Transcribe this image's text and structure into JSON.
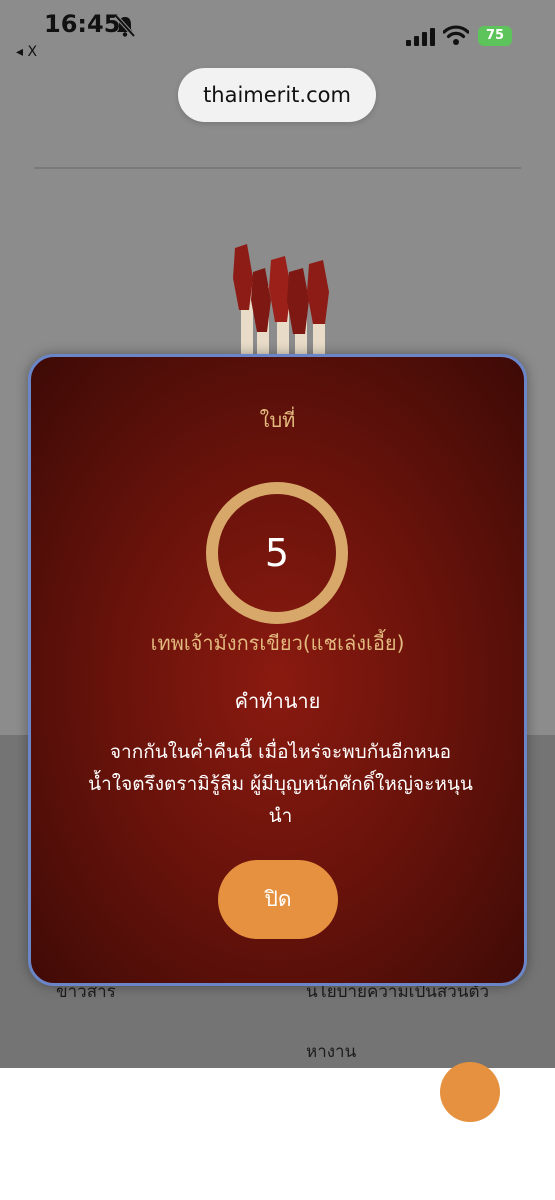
{
  "status_bar": {
    "time": "16:45",
    "back_app": "◂ X",
    "battery": "75"
  },
  "browser": {
    "url": "thaimerit.com"
  },
  "background_page": {
    "left_text": "ข่าวสาร",
    "right_text": "นโยบายความเป็นส่วนตัว",
    "jobs_text": "หางาน"
  },
  "modal": {
    "slip_label": "ใบที่",
    "slip_number": "5",
    "deity_name": "เทพเจ้ามังกรเขียว(แชเล่งเอี้ย)",
    "prediction_title": "คำทำนาย",
    "prediction_text": "จากกันในค่ำคืนนี้ เมื่อไหร่จะพบกันอีกหนอ น้ำใจตรึงตรามิรู้ลืม ผู้มีบุญหนักศักดิ์ใหญ่จะหนุนนำ",
    "close_label": "ปิด"
  },
  "colors": {
    "modal_red": "#7a160d",
    "gold": "#d8a86b",
    "button_orange": "#e6913f",
    "modal_border": "#6a86c8"
  }
}
